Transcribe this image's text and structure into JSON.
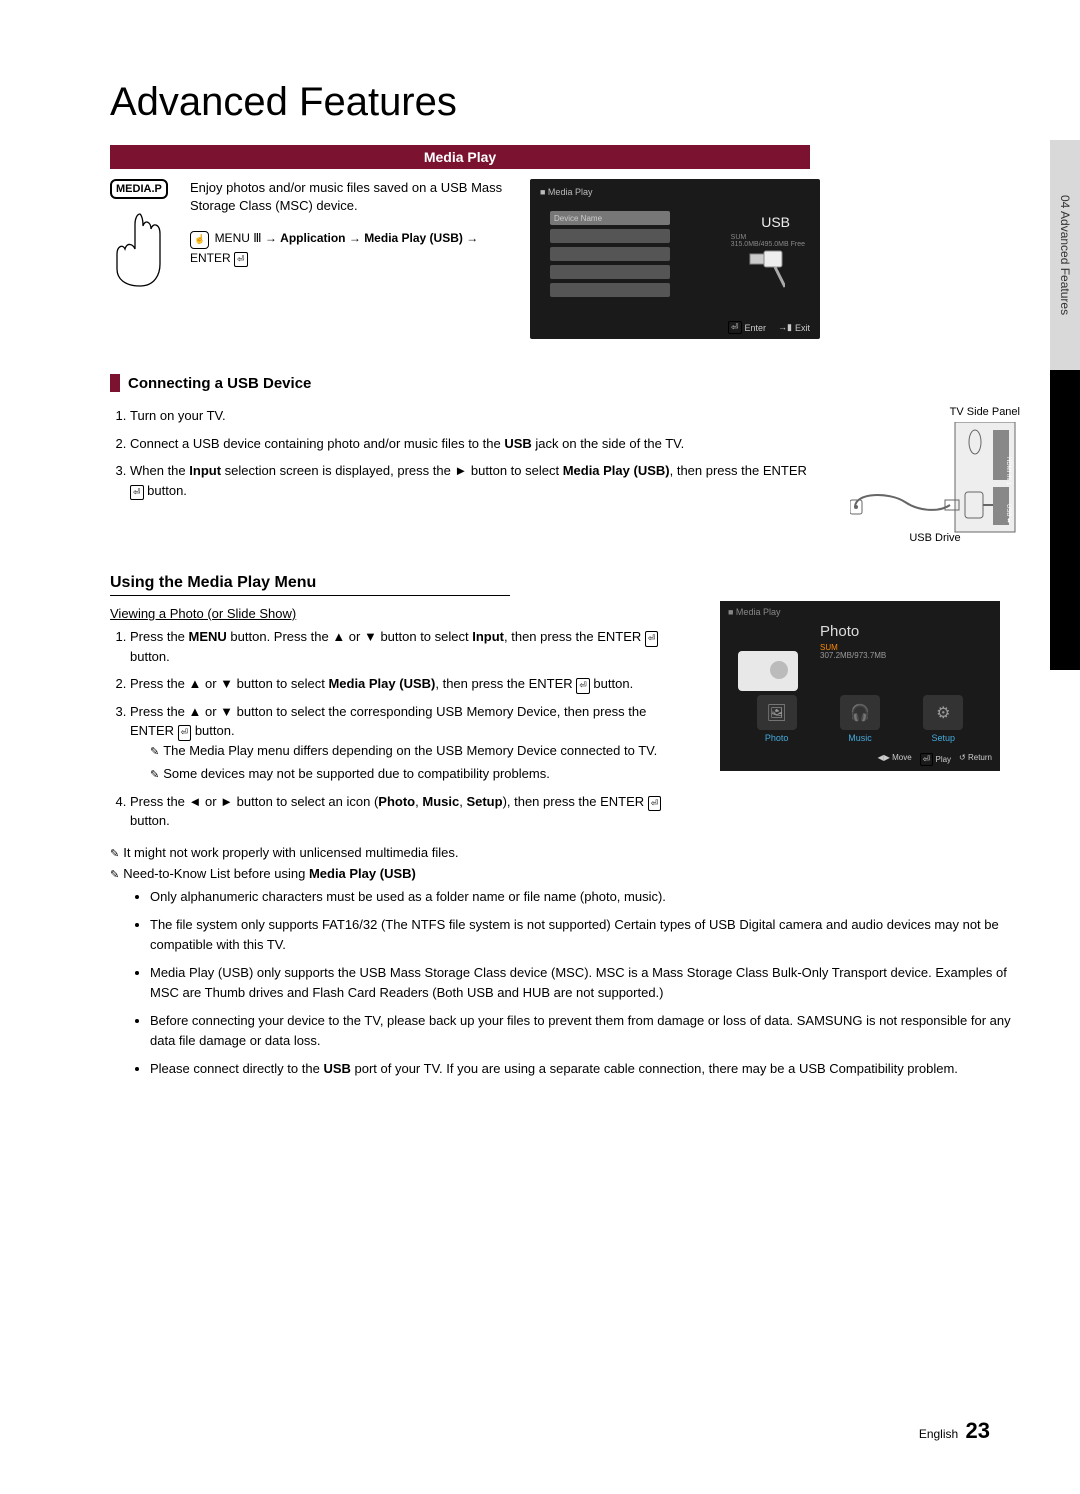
{
  "side_tab": "04   Advanced Features",
  "title": "Advanced Features",
  "banner": "Media Play",
  "intro": {
    "mediap": "MEDIA.P",
    "desc": "Enjoy photos and/or music files saved on a USB Mass Storage Class (MSC) device.",
    "menu_icon": "☝",
    "path": "MENU ⅿ → Application → Media Play (USB) → ENTER",
    "screenshot1": {
      "header": "■ Media Play",
      "device_name": "Device Name",
      "usb": "USB",
      "sum": "SUM",
      "free": "315.0MB/495.0MB Free",
      "footer_enter": "Enter",
      "footer_exit": "Exit"
    }
  },
  "sec1": {
    "title": "Connecting a USB Device",
    "panel_label": "TV Side Panel",
    "usb_drive": "USB Drive",
    "hdmi": "HDMI IN 1",
    "usb_port": "USB",
    "steps": [
      "Turn on your TV.",
      "Connect a USB device containing photo and/or music files to the USB jack on the side of the TV.",
      "When the Input selection screen is displayed, press the ► button to select Media Play (USB), then press the ENTER button."
    ]
  },
  "sec2": {
    "title": "Using the Media Play Menu",
    "subsub": "Viewing a Photo (or Slide Show)",
    "steps": [
      "Press the MENU button. Press the ▲ or ▼ button to select Input, then press the ENTER button.",
      "Press the ▲ or ▼ button to select Media Play (USB), then press the ENTER button.",
      "Press the ▲ or ▼ button to select the corresponding USB Memory Device, then press the ENTER button.",
      "Press the ◄ or ► button to select an icon (Photo, Music, Setup), then press the ENTER button."
    ],
    "sub_notes": [
      "The Media Play menu differs depending on the USB Memory Device connected to TV.",
      "Some devices may not be supported due to compatibility problems."
    ],
    "top_note1": "It might not work properly with unlicensed multimedia files.",
    "top_note2_prefix": "Need-to-Know List before using ",
    "top_note2_bold": "Media Play (USB)",
    "bullets": [
      "Only alphanumeric characters must be used as a folder name or file name (photo, music).",
      "The file system only supports FAT16/32 (The NTFS file system is not supported) Certain types of USB Digital camera and audio devices may not be compatible with this TV.",
      "Media Play (USB) only supports the USB Mass Storage Class device (MSC). MSC is a Mass Storage Class Bulk-Only Transport device. Examples of MSC are Thumb drives and Flash Card Readers (Both USB and HUB are not supported.)",
      "Before connecting your device to the TV, please back up your files to prevent them from damage or loss of data. SAMSUNG is not responsible for any data file damage or data loss.",
      "Please connect directly to the USB port of your TV. If you are using a separate cable connection, there may be a USB Compatibility problem."
    ],
    "screenshot2": {
      "header": "■ Media Play",
      "title": "Photo",
      "sum": "SUM",
      "size": "307.2MB/973.7MB",
      "icons": [
        "Photo",
        "Music",
        "Setup"
      ],
      "footer_move": "Move",
      "footer_play": "Play",
      "footer_return": "Return"
    }
  },
  "footer": {
    "lang": "English",
    "page": "23"
  }
}
